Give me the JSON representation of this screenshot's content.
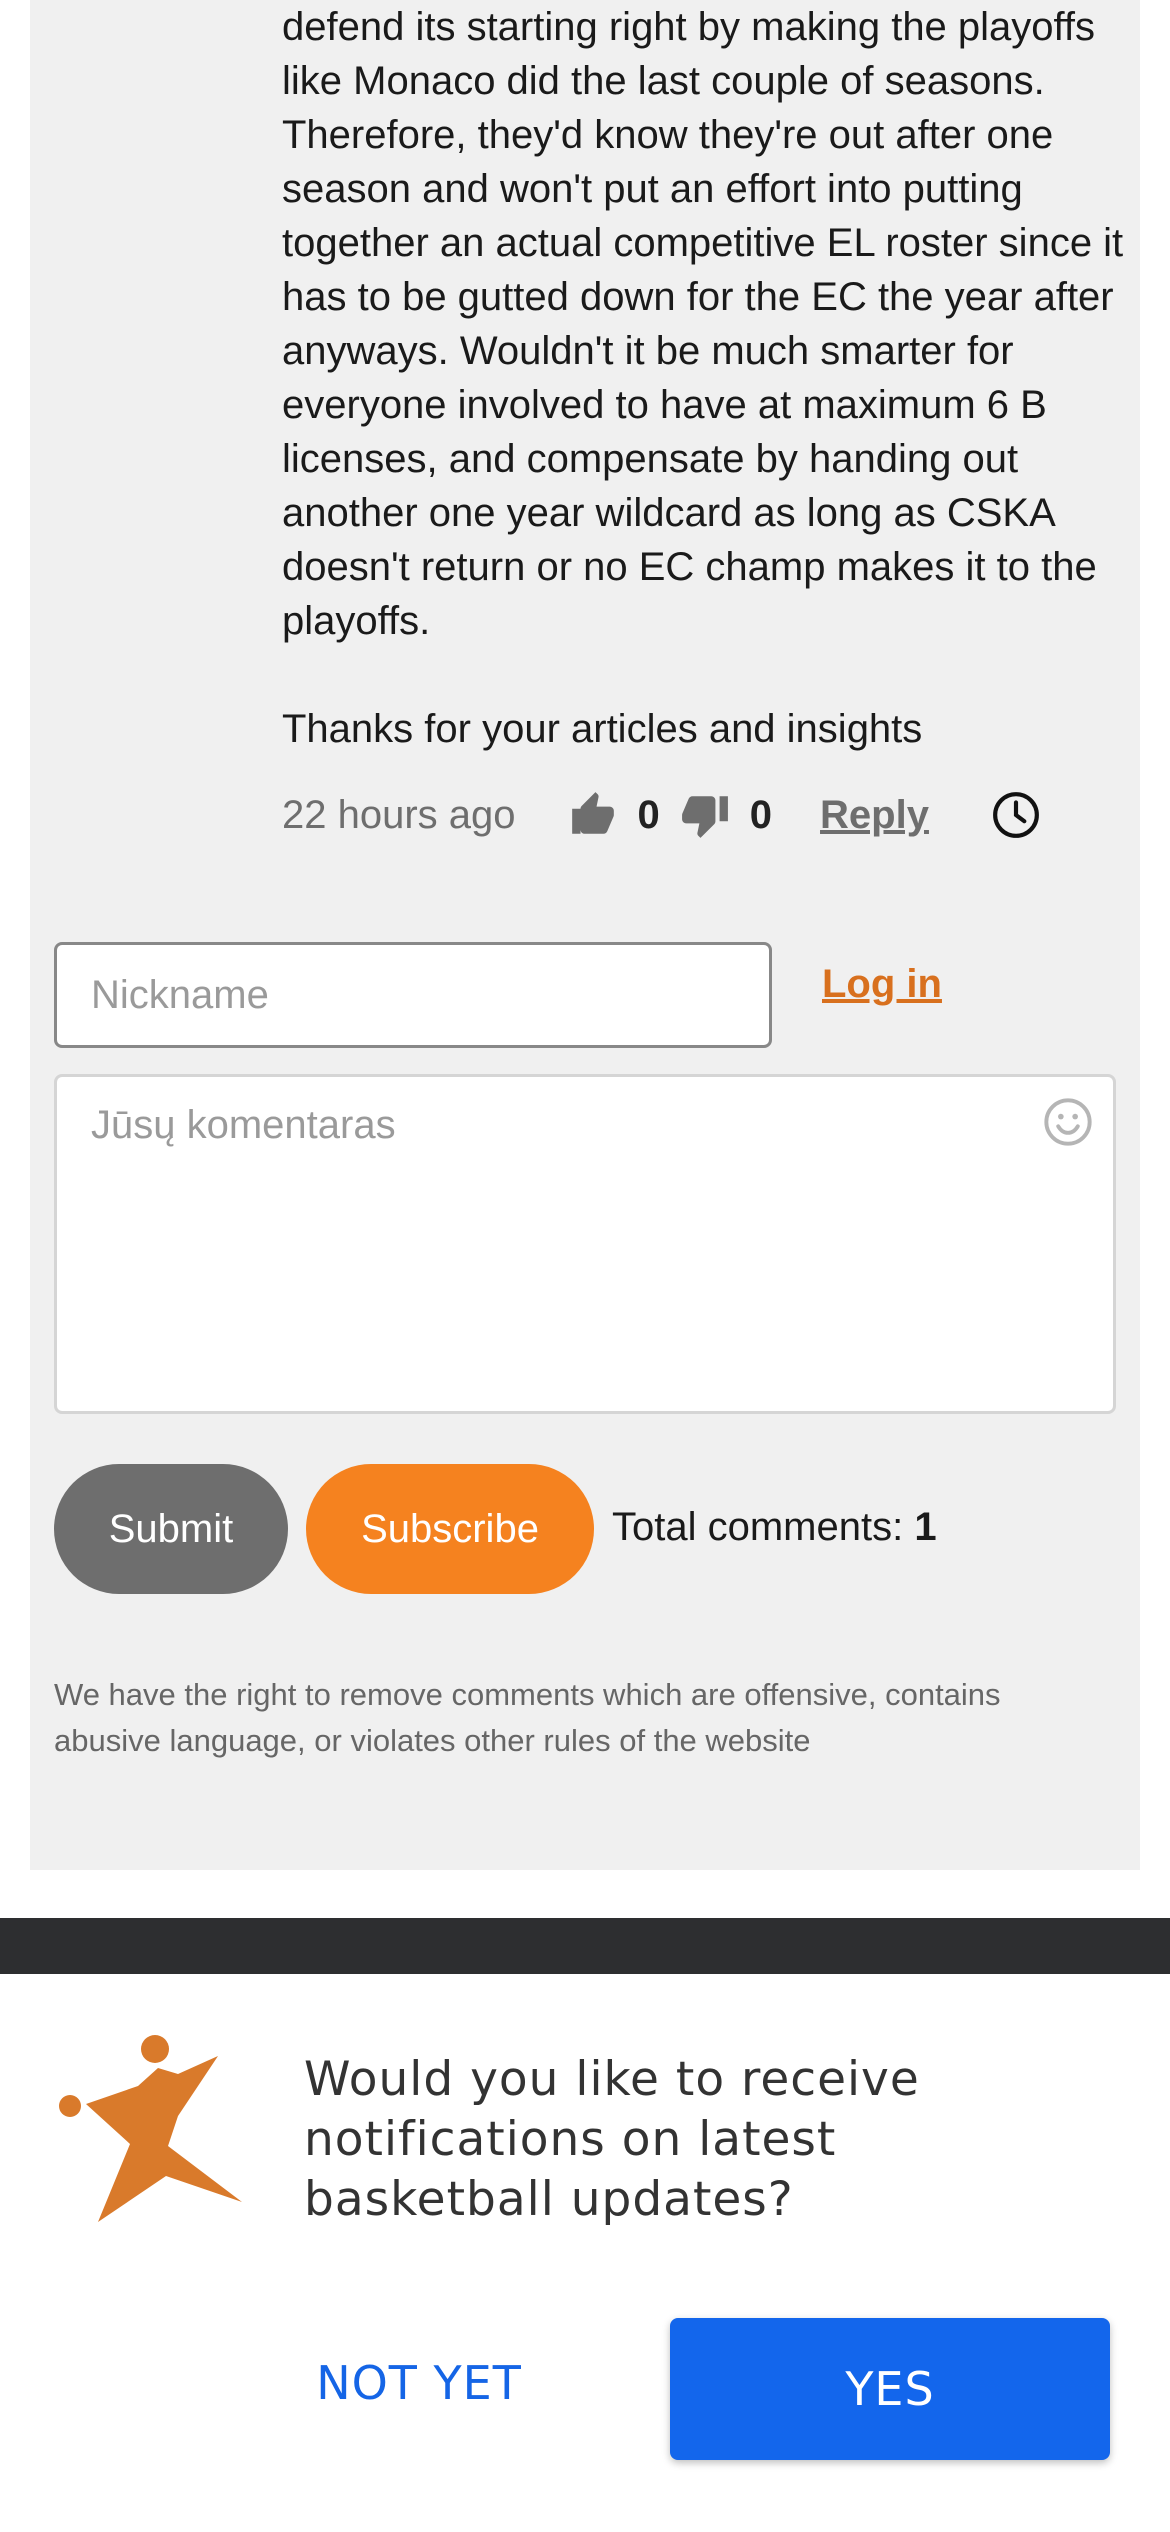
{
  "comment": {
    "paragraphs": [
      "defend its starting right by making the playoffs like Monaco did the last couple of seasons. Therefore, they'd know they're out after one season and won't put an effort into putting together an actual competitive EL roster since it has to be gutted down for the EC the year after anyways. Wouldn't it be much smarter for everyone involved to have at maximum 6 B licenses, and compensate by handing out another one year wildcard as long as CSKA doesn't return or no EC champ makes it to the playoffs.",
      "Thanks for your articles and insights"
    ],
    "time": "22 hours ago",
    "upvotes": "0",
    "downvotes": "0",
    "reply_label": "Reply"
  },
  "form": {
    "nickname_placeholder": "Nickname",
    "login_label": "Log in",
    "comment_placeholder": "Jūsų komentaras",
    "submit_label": "Submit",
    "subscribe_label": "Subscribe",
    "total_label": "Total comments:",
    "total_count": "1",
    "disclaimer": "We have the right to remove comments which are offensive, contains abusive language, or violates other rules of the website"
  },
  "notification": {
    "message": "Would you like to receive notifications on latest basketball updates?",
    "not_yet_label": "NOT YET",
    "yes_label": "YES"
  },
  "icons": {
    "like": "thumbs-up-icon",
    "dislike": "thumbs-down-icon",
    "clock": "clock-icon",
    "emoji": "smiley-icon",
    "logo": "basketball-player-logo"
  },
  "colors": {
    "accent_orange": "#f5821f",
    "login_link": "#d8701e",
    "submit_gray": "#6e6e6e",
    "panel_bg": "#f0f0f0",
    "yes_blue": "#1366ec",
    "dark_bar": "#2d2e30"
  }
}
